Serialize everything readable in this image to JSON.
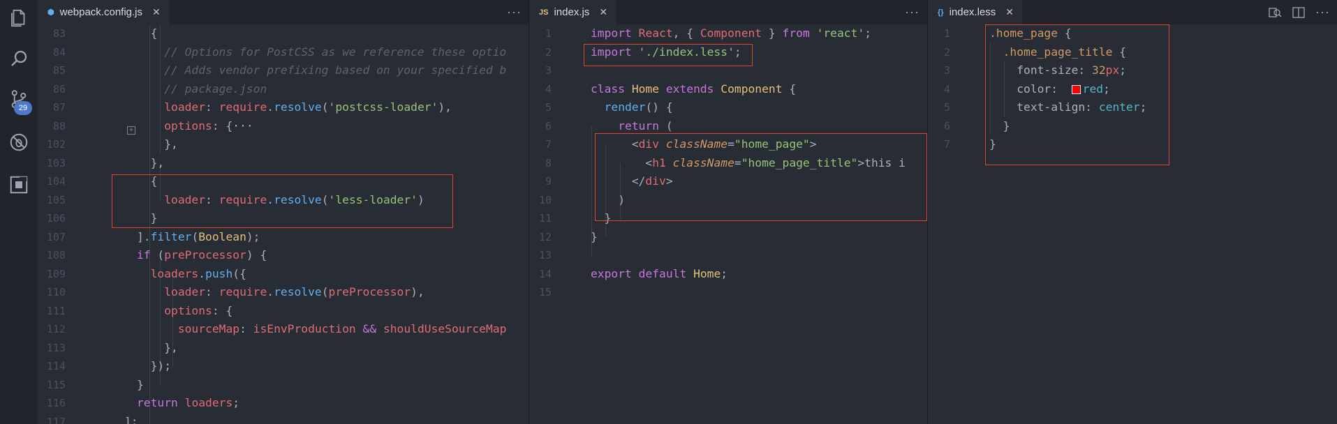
{
  "activity_bar": {
    "scm_badge": "29"
  },
  "panes": [
    {
      "tab": {
        "icon": "webpack-icon",
        "label": "webpack.config.js",
        "close": "✕"
      },
      "more": "···",
      "line_numbers": [
        "83",
        "84",
        "85",
        "86",
        "87",
        "88",
        "102",
        "103",
        "104",
        "105",
        "106",
        "107",
        "108",
        "109",
        "110",
        "111",
        "112",
        "113",
        "114",
        "115",
        "116",
        "117"
      ]
    },
    {
      "tab": {
        "icon": "JS",
        "label": "index.js",
        "close": "✕"
      },
      "more": "···",
      "line_numbers": [
        "1",
        "2",
        "3",
        "4",
        "5",
        "6",
        "7",
        "8",
        "9",
        "10",
        "11",
        "12",
        "13",
        "14",
        "15"
      ]
    },
    {
      "tab": {
        "icon": "{}",
        "label": "index.less",
        "close": "✕"
      },
      "line_numbers": [
        "1",
        "2",
        "3",
        "4",
        "5",
        "6",
        "7"
      ]
    }
  ],
  "colors": {
    "highlight_box": "#e0452f",
    "badge": "#4d78cc",
    "swatch": "#ff0000"
  }
}
